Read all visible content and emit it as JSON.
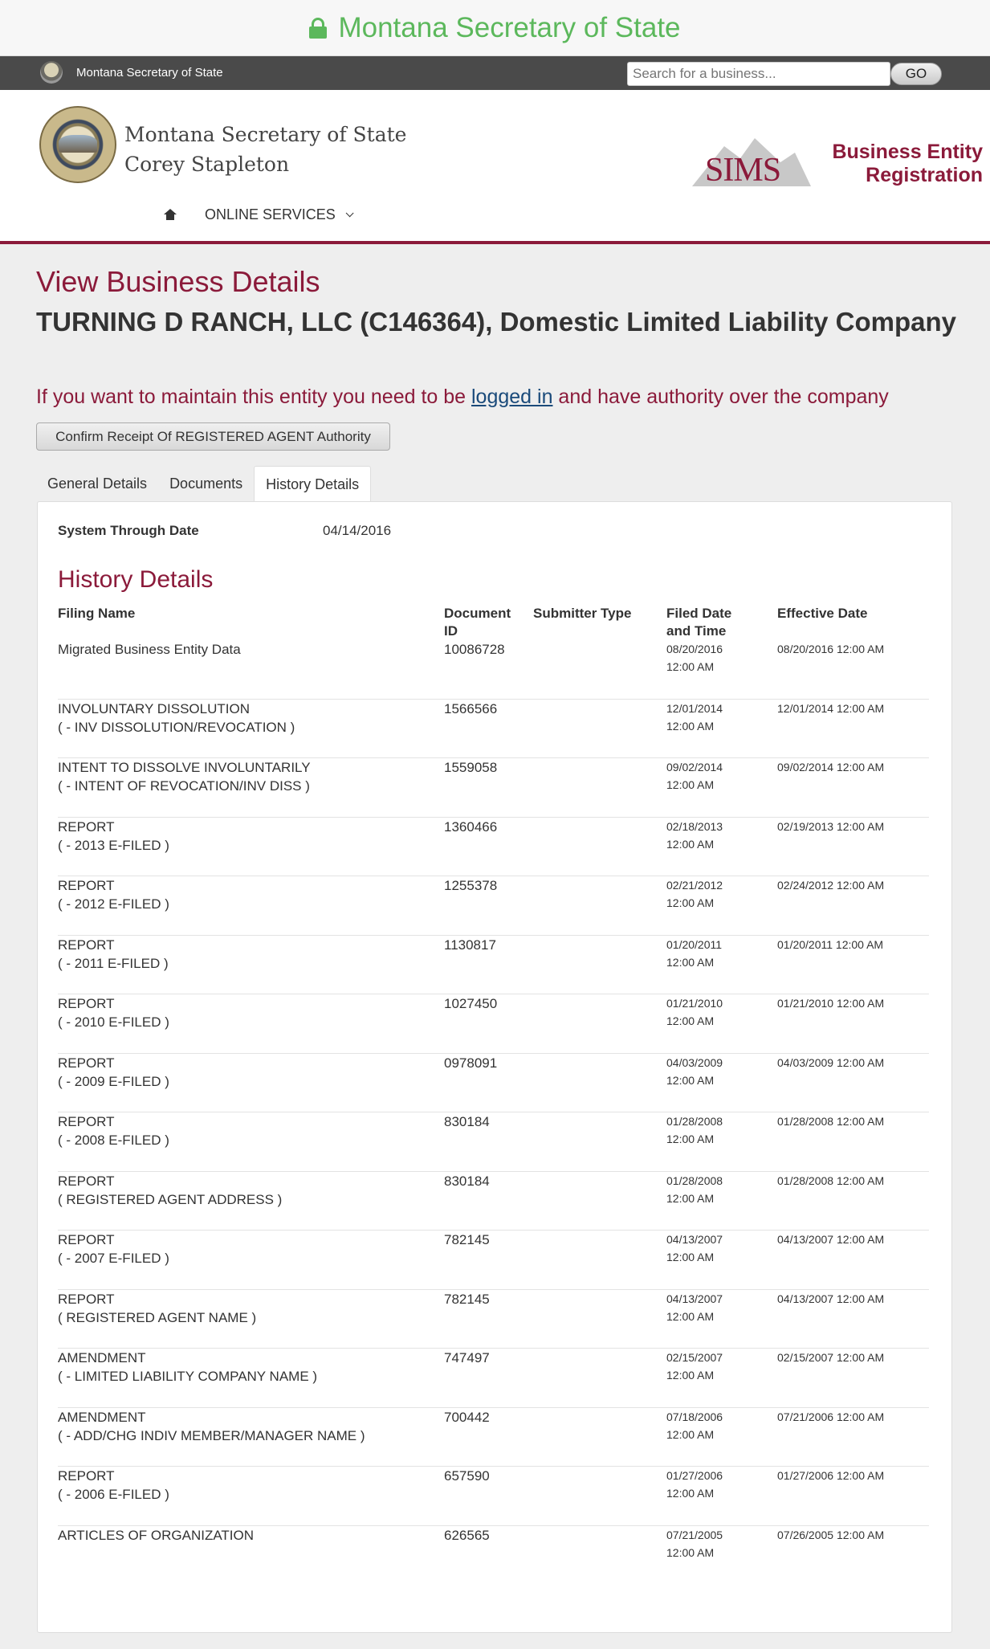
{
  "browser": {
    "title": "Montana Secretary of State"
  },
  "topnav": {
    "site_name": "Montana Secretary of State",
    "search_placeholder": "Search for a business...",
    "go_label": "GO"
  },
  "header": {
    "org_line1": "Montana Secretary of State",
    "org_line2": "Corey Stapleton",
    "sims_logo": "SIMS",
    "ber_line1": "Business Entity",
    "ber_line2": "Registration",
    "menu_online_services": "ONLINE SERVICES"
  },
  "page": {
    "heading": "View Business Details",
    "entity_title": "TURNING D RANCH, LLC (C146364), Domestic Limited Liability Company",
    "notice_before": "If you want to maintain this entity you need to be ",
    "notice_link": "logged in",
    "notice_after": " and have authority over the company",
    "confirm_button": "Confirm Receipt Of REGISTERED AGENT Authority"
  },
  "tabs": [
    "General Details",
    "Documents",
    "History Details"
  ],
  "active_tab": "History Details",
  "details": {
    "system_through_label": "System Through Date",
    "system_through_value": "04/14/2016",
    "history_heading": "History Details"
  },
  "table": {
    "columns": {
      "filing_name": "Filing Name",
      "document_id": "Document ID",
      "submitter_type": "Submitter Type",
      "filed": "Filed Date and Time",
      "effective": "Effective Date"
    },
    "rows": [
      {
        "name": "Migrated Business Entity Data",
        "sub": "",
        "doc": "10086728",
        "submitter": "",
        "filed_date": "08/20/2016",
        "filed_time": "12:00 AM",
        "effective": "08/20/2016 12:00 AM"
      },
      {
        "name": "INVOLUNTARY DISSOLUTION",
        "sub": "( - INV DISSOLUTION/REVOCATION )",
        "doc": "1566566",
        "submitter": "",
        "filed_date": "12/01/2014",
        "filed_time": "12:00 AM",
        "effective": "12/01/2014 12:00 AM"
      },
      {
        "name": "INTENT TO DISSOLVE INVOLUNTARILY",
        "sub": "( - INTENT OF REVOCATION/INV DISS )",
        "doc": "1559058",
        "submitter": "",
        "filed_date": "09/02/2014",
        "filed_time": "12:00 AM",
        "effective": "09/02/2014 12:00 AM"
      },
      {
        "name": "REPORT",
        "sub": "( - 2013 E-FILED )",
        "doc": "1360466",
        "submitter": "",
        "filed_date": "02/18/2013",
        "filed_time": "12:00 AM",
        "effective": "02/19/2013 12:00 AM"
      },
      {
        "name": "REPORT",
        "sub": "( - 2012 E-FILED )",
        "doc": "1255378",
        "submitter": "",
        "filed_date": "02/21/2012",
        "filed_time": "12:00 AM",
        "effective": "02/24/2012 12:00 AM"
      },
      {
        "name": "REPORT",
        "sub": "( - 2011 E-FILED )",
        "doc": "1130817",
        "submitter": "",
        "filed_date": "01/20/2011",
        "filed_time": "12:00 AM",
        "effective": "01/20/2011 12:00 AM"
      },
      {
        "name": "REPORT",
        "sub": "( - 2010 E-FILED )",
        "doc": "1027450",
        "submitter": "",
        "filed_date": "01/21/2010",
        "filed_time": "12:00 AM",
        "effective": "01/21/2010 12:00 AM"
      },
      {
        "name": "REPORT",
        "sub": "( - 2009 E-FILED )",
        "doc": "0978091",
        "submitter": "",
        "filed_date": "04/03/2009",
        "filed_time": "12:00 AM",
        "effective": "04/03/2009 12:00 AM"
      },
      {
        "name": "REPORT",
        "sub": "( - 2008 E-FILED )",
        "doc": "830184",
        "submitter": "",
        "filed_date": "01/28/2008",
        "filed_time": "12:00 AM",
        "effective": "01/28/2008 12:00 AM"
      },
      {
        "name": "REPORT",
        "sub": "( REGISTERED AGENT ADDRESS )",
        "doc": "830184",
        "submitter": "",
        "filed_date": "01/28/2008",
        "filed_time": "12:00 AM",
        "effective": "01/28/2008 12:00 AM"
      },
      {
        "name": "REPORT",
        "sub": "( - 2007 E-FILED )",
        "doc": "782145",
        "submitter": "",
        "filed_date": "04/13/2007",
        "filed_time": "12:00 AM",
        "effective": "04/13/2007 12:00 AM"
      },
      {
        "name": "REPORT",
        "sub": "( REGISTERED AGENT NAME )",
        "doc": "782145",
        "submitter": "",
        "filed_date": "04/13/2007",
        "filed_time": "12:00 AM",
        "effective": "04/13/2007 12:00 AM"
      },
      {
        "name": "AMENDMENT",
        "sub": "( - LIMITED LIABILITY COMPANY NAME )",
        "doc": "747497",
        "submitter": "",
        "filed_date": "02/15/2007",
        "filed_time": "12:00 AM",
        "effective": "02/15/2007 12:00 AM"
      },
      {
        "name": "AMENDMENT",
        "sub": "( - ADD/CHG INDIV MEMBER/MANAGER NAME )",
        "doc": "700442",
        "submitter": "",
        "filed_date": "07/18/2006",
        "filed_time": "12:00 AM",
        "effective": "07/21/2006 12:00 AM"
      },
      {
        "name": "REPORT",
        "sub": "( - 2006 E-FILED )",
        "doc": "657590",
        "submitter": "",
        "filed_date": "01/27/2006",
        "filed_time": "12:00 AM",
        "effective": "01/27/2006 12:00 AM"
      },
      {
        "name": "ARTICLES OF ORGANIZATION",
        "sub": "",
        "doc": "626565",
        "submitter": "",
        "filed_date": "07/21/2005",
        "filed_time": "12:00 AM",
        "effective": "07/26/2005 12:00 AM"
      }
    ]
  },
  "colors": {
    "brand_red": "#8b1a3a",
    "secure_green": "#5cb85c",
    "nav_dark": "#4a4a4a"
  }
}
